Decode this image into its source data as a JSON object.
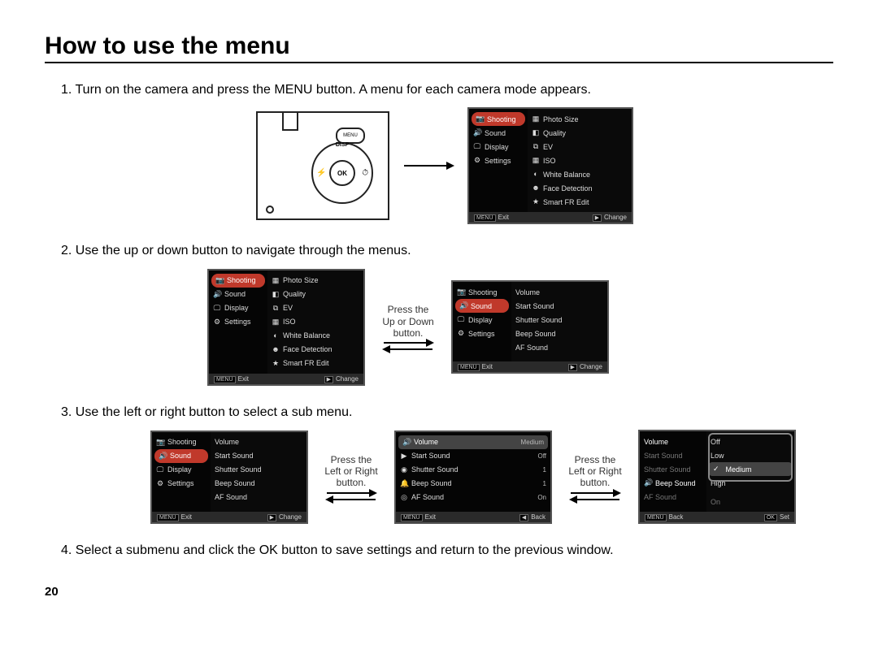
{
  "title": "How to use the menu",
  "page_number": "20",
  "steps": {
    "s1": "1. Turn on the camera and press the MENU button. A menu for each camera mode appears.",
    "s2": "2. Use the up or down button to navigate through the menus.",
    "s3": "3. Use the left or right button to select a sub menu.",
    "s4": "4. Select a submenu and click the OK button to save settings and return to the previous window."
  },
  "camera": {
    "menu_label": "MENU",
    "ok_label": "OK",
    "disp_label": "DISP"
  },
  "captions": {
    "updown": "Press the\nUp or Down\nbutton.",
    "leftright": "Press the\nLeft or Right\nbutton."
  },
  "menu_left": {
    "shooting": "Shooting",
    "sound": "Sound",
    "display": "Display",
    "settings": "Settings"
  },
  "menu_right_shooting": {
    "photo_size": "Photo Size",
    "quality": "Quality",
    "ev": "EV",
    "iso": "ISO",
    "white_balance": "White Balance",
    "face_detection": "Face Detection",
    "smart_fr": "Smart FR Edit"
  },
  "menu_right_sound": {
    "volume": "Volume",
    "start_sound": "Start Sound",
    "shutter_sound": "Shutter Sound",
    "beep_sound": "Beep Sound",
    "af_sound": "AF Sound"
  },
  "values_screen": {
    "volume": {
      "label": "Volume",
      "val": "Medium"
    },
    "start_sound": {
      "label": "Start Sound",
      "val": "Off"
    },
    "shutter_sound": {
      "label": "Shutter Sound",
      "val": "1"
    },
    "beep_sound": {
      "label": "Beep Sound",
      "val": "1"
    },
    "af_sound": {
      "label": "AF Sound",
      "val": "On"
    }
  },
  "volume_options": {
    "off": "Off",
    "low": "Low",
    "medium": "Medium",
    "high": "High",
    "on": "On"
  },
  "footer": {
    "menu": "MENU",
    "exit": "Exit",
    "change": "Change",
    "back": "Back",
    "set": "Set",
    "ok": "OK"
  }
}
